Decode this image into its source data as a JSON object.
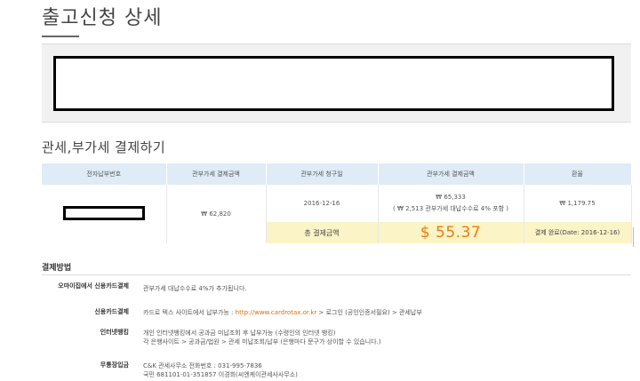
{
  "page": {
    "title": "출고신청 상세"
  },
  "payment": {
    "section_title": "관세,부가세 결제하기",
    "headers": [
      "전자납부번호",
      "관부가세 결제금액",
      "관부가세 청구일",
      "관부가세 결제금액",
      "환율"
    ],
    "row": {
      "amount_krw": "₩ 62,820",
      "bill_date": "2016-12-16",
      "amount_with_fee": "₩ 65,333",
      "fee_note": "( ₩ 2,513 관부가세 대납수수료 4% 포함 )",
      "exchange_rate": "₩ 1,179.75"
    },
    "total": {
      "label": "총 결제금액",
      "amount": "$ 55.37",
      "status": "결제 완료(Date: 2016-12-16)"
    }
  },
  "methods": {
    "title": "결제방법",
    "items": [
      {
        "label": "오마이집에서 신용카드결제",
        "desc": "관부가세 대납수수료 4%가 추가됩니다."
      },
      {
        "label": "신용카드결제",
        "desc_prefix": "카드로 텍스 사이트에서 납부가능 : ",
        "link": "http://www.cardrotax.or.kr",
        "desc_suffix": " > 로그인 (공인인증서필요) > 관세납부"
      },
      {
        "label": "인터넷뱅킹",
        "desc": "개인 인터넷뱅킹에서 공과금 미납조회 후 납부가능 (수령인의 인터넷 뱅킹)",
        "desc2": "각 은행사이트 > 공과금/법원 > 관세 미납조회/납부 (은행마다 문구가 상이할 수 있습니다.)"
      },
      {
        "label": "무통장입금",
        "desc": "C&K 관세사무소 전화번호 : 031-995-7836",
        "desc2": "국민 681101-01-351857 이경희(씨엔케이관세사사무소)"
      }
    ]
  }
}
